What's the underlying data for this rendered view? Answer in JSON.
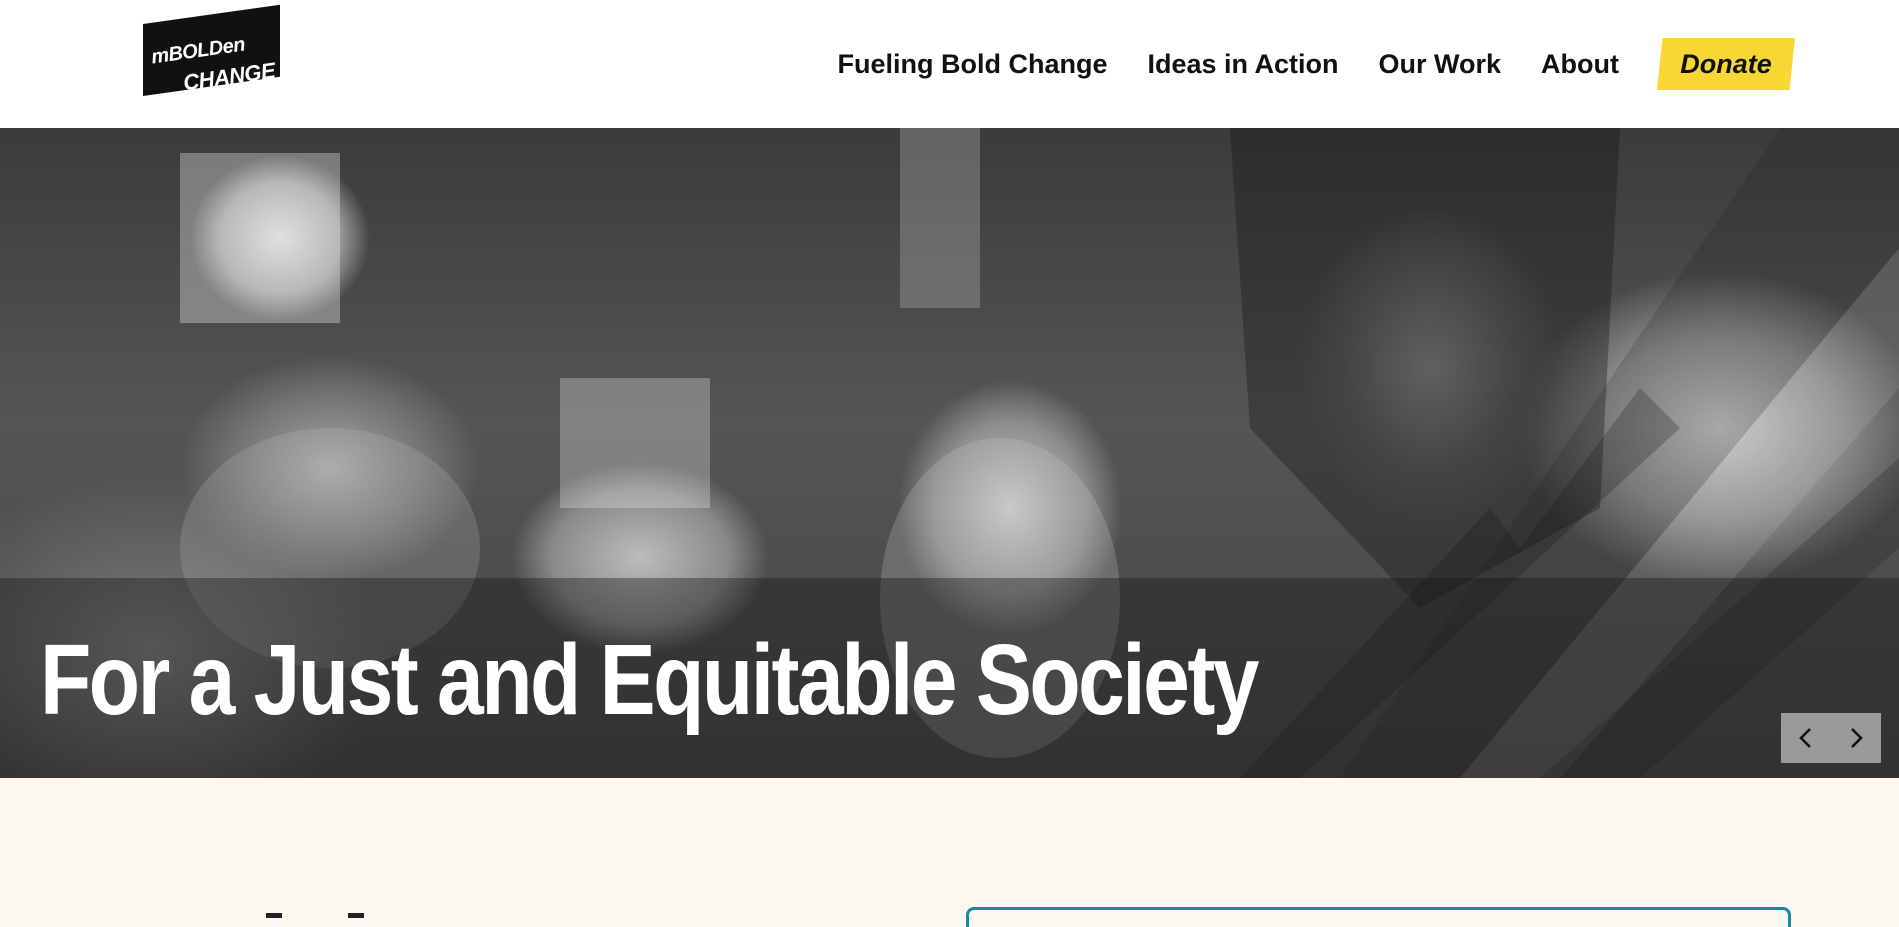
{
  "header": {
    "logo": {
      "line1": "mBOLDen",
      "line2": "CHANGE"
    },
    "nav": [
      {
        "label": "Fueling Bold Change"
      },
      {
        "label": "Ideas in Action"
      },
      {
        "label": "Our Work"
      },
      {
        "label": "About"
      }
    ],
    "donate_label": "Donate"
  },
  "hero": {
    "title": "For a Just and Equitable Society",
    "prev_icon": "chevron-left-icon",
    "next_icon": "chevron-right-icon"
  },
  "colors": {
    "donate_yellow": "#f8d633",
    "card_teal": "#1a8aa0",
    "section_bg": "#fbf8f0"
  }
}
